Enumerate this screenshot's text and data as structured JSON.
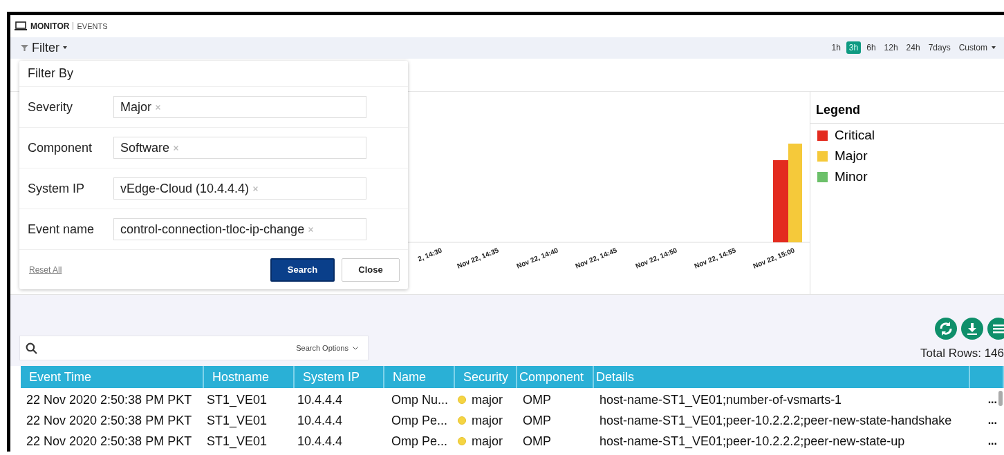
{
  "header": {
    "section": "MONITOR",
    "page": "EVENTS"
  },
  "filter_bar": {
    "label": "Filter",
    "time_ranges": [
      {
        "label": "1h",
        "selected": false
      },
      {
        "label": "3h",
        "selected": true
      },
      {
        "label": "6h",
        "selected": false
      },
      {
        "label": "12h",
        "selected": false
      },
      {
        "label": "24h",
        "selected": false
      },
      {
        "label": "7days",
        "selected": false
      }
    ],
    "custom": "Custom"
  },
  "filter_panel": {
    "title": "Filter By",
    "fields": [
      {
        "label": "Severity",
        "value": "Major"
      },
      {
        "label": "Component",
        "value": "Software"
      },
      {
        "label": "System IP",
        "value": "vEdge-Cloud (10.4.4.4)"
      },
      {
        "label": "Event name",
        "value": "control-connection-tloc-ip-change"
      }
    ],
    "reset": "Reset All",
    "buttons": [
      {
        "label": "Search",
        "kind": "primary"
      },
      {
        "label": "Close",
        "kind": "secondary"
      }
    ]
  },
  "chart": {
    "x_labels": [
      "2, 14:30",
      "Nov 22, 14:35",
      "Nov 22, 14:40",
      "Nov 22, 14:45",
      "Nov 22, 14:50",
      "Nov 22, 14:55",
      "Nov 22, 15:00"
    ],
    "legend": {
      "title": "Legend",
      "items": [
        {
          "label": "Critical",
          "color": "#e32b1f"
        },
        {
          "label": "Major",
          "color": "#f5c93a"
        },
        {
          "label": "Minor",
          "color": "#6cc06a"
        }
      ]
    }
  },
  "total_rows": "Total Rows: 146",
  "search": {
    "options": "Search Options"
  },
  "table": {
    "columns": [
      "Event Time",
      "Hostname",
      "System IP",
      "Name",
      "Security",
      "Component",
      "Details"
    ],
    "rows": [
      {
        "event_time": "22 Nov 2020 2:50:38 PM PKT",
        "hostname": "ST1_VE01",
        "system_ip": "10.4.4.4",
        "name": "Omp Nu...",
        "security": "major",
        "component": "OMP",
        "details": "host-name-ST1_VE01;number-of-vsmarts-1",
        "actions": "..."
      },
      {
        "event_time": "22 Nov 2020 2:50:38 PM PKT",
        "hostname": "ST1_VE01",
        "system_ip": "10.4.4.4",
        "name": "Omp Pe...",
        "security": "major",
        "component": "OMP",
        "details": "host-name-ST1_VE01;peer-10.2.2.2;peer-new-state-handshake",
        "actions": "..."
      },
      {
        "event_time": "22 Nov 2020 2:50:38 PM PKT",
        "hostname": "ST1_VE01",
        "system_ip": "10.4.4.4",
        "name": "Omp Pe...",
        "security": "major",
        "component": "OMP",
        "details": "host-name-ST1_VE01;peer-10.2.2.2;peer-new-state-up",
        "actions": "..."
      }
    ]
  }
}
